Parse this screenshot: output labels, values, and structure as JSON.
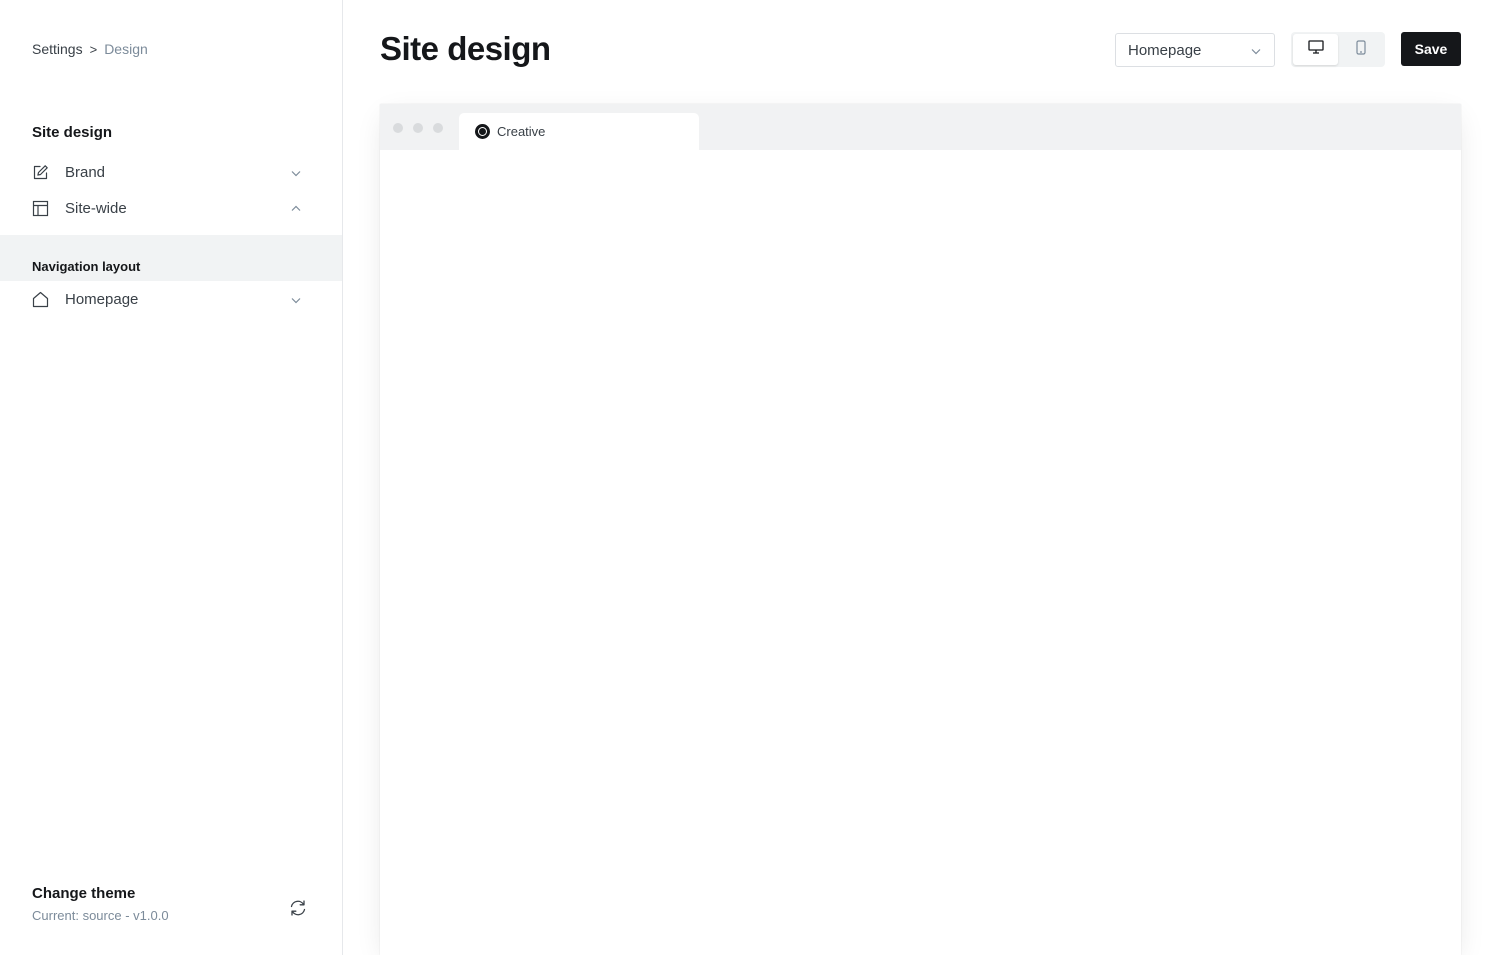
{
  "breadcrumb": {
    "parent": "Settings",
    "separator": ">",
    "current": "Design"
  },
  "sidebar": {
    "section_title": "Site design",
    "items": [
      {
        "label": "Brand",
        "icon": "edit-icon",
        "expanded": false
      },
      {
        "label": "Site-wide",
        "icon": "layout-icon",
        "expanded": true
      }
    ],
    "nav_layout_label": "Navigation layout",
    "nav_items": [
      {
        "label": "Homepage",
        "icon": "home-icon",
        "expanded": false
      }
    ],
    "theme": {
      "title": "Change theme",
      "current": "Current: source - v1.0.0"
    }
  },
  "header": {
    "title": "Site design",
    "page_select": {
      "value": "Homepage"
    },
    "device_toggle": {
      "selected": "desktop"
    },
    "save_label": "Save"
  },
  "preview": {
    "tab_title": "Creative"
  },
  "colors": {
    "primary_button": "#15171a",
    "sidebar_highlight": "#f1f3f4",
    "muted_text": "#7c8b9a"
  }
}
